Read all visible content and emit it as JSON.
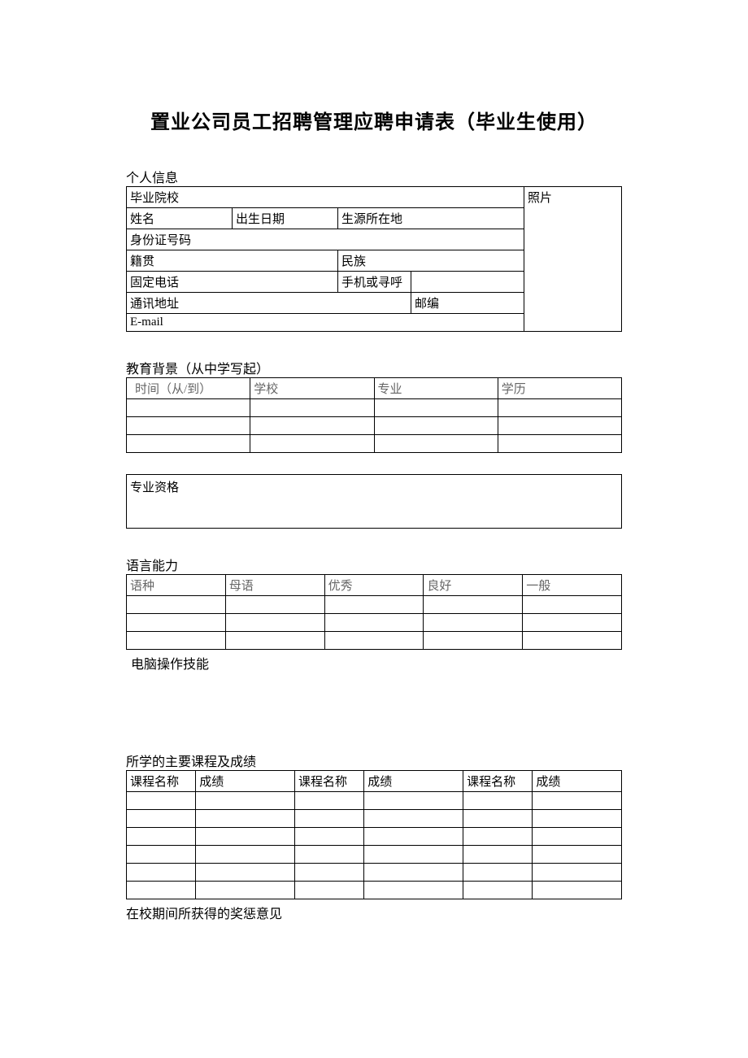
{
  "title": "置业公司员工招聘管理应聘申请表（毕业生使用）",
  "sections": {
    "personal_heading": "个人信息",
    "education_heading": "教育背景（从中学写起）",
    "qualification_heading": "专业资格",
    "language_heading": "语言能力",
    "computer_heading": "电脑操作技能",
    "courses_heading": "所学的主要课程及成绩",
    "awards_heading": "在校期间所获得的奖惩意见"
  },
  "personal": {
    "school_label": "毕业院校",
    "photo_label": "照片",
    "name_label": "姓名",
    "birth_label": "出生日期",
    "origin_label": "生源所在地",
    "id_label": "身份证号码",
    "native_label": "籍贯",
    "ethnic_label": "民族",
    "phone_label": "固定电话",
    "mobile_label": "手机或寻呼",
    "address_label": "通讯地址",
    "zip_label": "邮编",
    "email_label": "E-mail"
  },
  "education": {
    "col_time": "时间（从/到）",
    "col_school": "学校",
    "col_major": "专业",
    "col_degree": "学历"
  },
  "language": {
    "col_lang": "语种",
    "col_native": "母语",
    "col_excellent": "优秀",
    "col_good": "良好",
    "col_fair": "一般"
  },
  "courses": {
    "col_name": "课程名称",
    "col_score": "成绩"
  }
}
